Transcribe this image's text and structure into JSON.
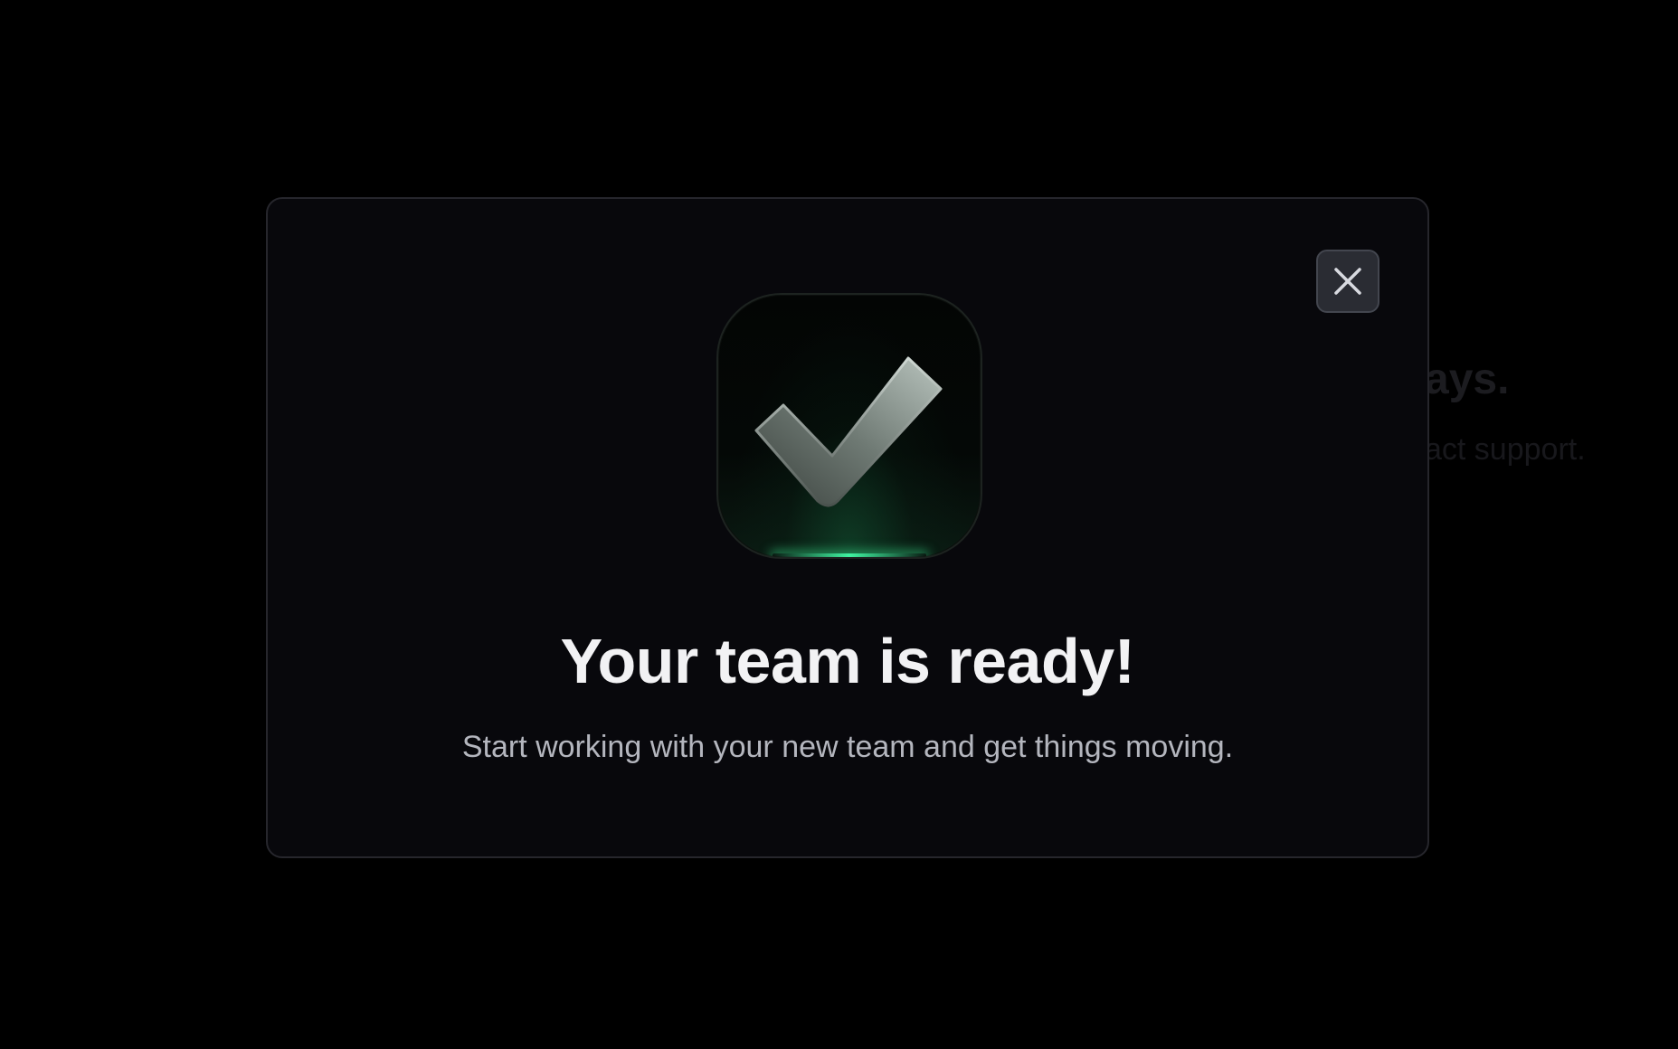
{
  "background": {
    "heading_fragment": "ays.",
    "sub_fragment": "act support."
  },
  "modal": {
    "title": "Your team is ready!",
    "subtitle": "Start working with your new team and get things moving.",
    "close_icon": "close-icon",
    "hero_icon": "checkmark-icon"
  },
  "colors": {
    "backdrop": "#000000",
    "modal_bg": "#08080c",
    "accent_glow": "#3ff2a0",
    "title": "#f2f2f4",
    "subtitle": "#b4b6be"
  }
}
